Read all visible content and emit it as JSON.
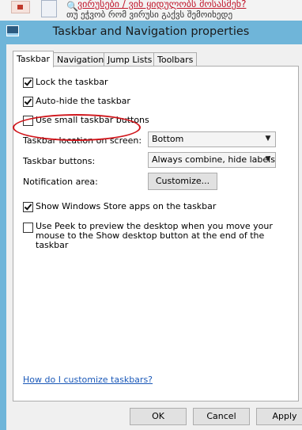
{
  "background": {
    "line1": "ვირუსები / ვინ ყიდულობს მოსასმენ?",
    "line2": "თუ ეჭვობ რომ ვირუსი გაქვს შემოიხედე"
  },
  "window": {
    "title": "Taskbar and Navigation properties",
    "icon": "taskbar-properties-icon"
  },
  "tabs": [
    {
      "label": "Taskbar",
      "active": true
    },
    {
      "label": "Navigation",
      "active": false
    },
    {
      "label": "Jump Lists",
      "active": false
    },
    {
      "label": "Toolbars",
      "active": false
    }
  ],
  "options": {
    "lock": {
      "label": "Lock the taskbar",
      "checked": true
    },
    "autohide": {
      "label": "Auto-hide the taskbar",
      "checked": true
    },
    "small_buttons": {
      "label": "Use small taskbar buttons",
      "checked": false
    }
  },
  "location": {
    "label": "Taskbar location on screen:",
    "value": "Bottom"
  },
  "buttons": {
    "label": "Taskbar buttons:",
    "value": "Always combine, hide labels"
  },
  "notification": {
    "label": "Notification area:",
    "button": "Customize..."
  },
  "store_apps": {
    "label": "Show Windows Store apps on the taskbar",
    "checked": true
  },
  "peek": {
    "label": "Use Peek to preview the desktop when you move your mouse to the Show desktop button at the end of the taskbar",
    "checked": false
  },
  "help_link": "How do I customize taskbars?",
  "footer": {
    "ok": "OK",
    "cancel": "Cancel",
    "apply": "Apply"
  },
  "colors": {
    "title_bar": "#6fb5d9",
    "annotation": "#d0161c",
    "link": "#1a58b8"
  }
}
